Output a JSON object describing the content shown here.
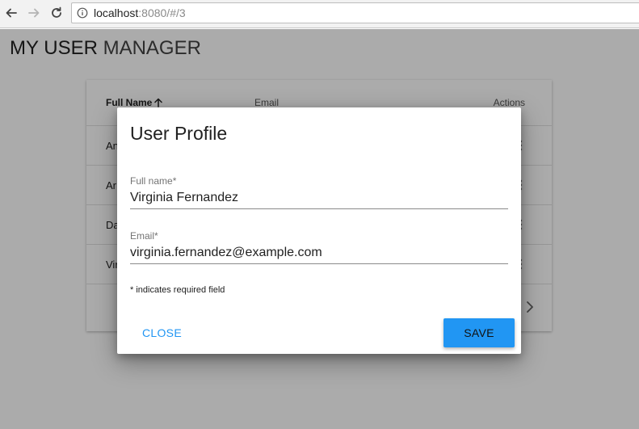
{
  "browser": {
    "url_host": "localhost",
    "url_rest": ":8080/#/3"
  },
  "app": {
    "title_first": "MY USER",
    "title_second": "MANAGER"
  },
  "table": {
    "headers": {
      "full_name": "Full Name",
      "email": "Email",
      "actions": "Actions"
    },
    "rows": [
      {
        "name_visible": "An"
      },
      {
        "name_visible": "Ar"
      },
      {
        "name_visible": "Da"
      },
      {
        "name_visible": "Vir"
      }
    ]
  },
  "dialog": {
    "title": "User Profile",
    "fields": [
      {
        "label": "Full name*",
        "value": "Virginia Fernandez"
      },
      {
        "label": "Email*",
        "value": "virginia.fernandez@example.com"
      }
    ],
    "required_note": "* indicates required field",
    "close_label": "CLOSE",
    "save_label": "SAVE"
  },
  "colors": {
    "primary": "#2196f3",
    "scrim": "rgba(0,0,0,0.33)"
  },
  "icons": {
    "back": "arrow-left-icon",
    "forward": "arrow-right-icon",
    "reload": "reload-icon",
    "info": "info-icon",
    "sort": "arrow-up-icon",
    "actions": "more-vert-icon",
    "next_page": "chevron-right-icon"
  }
}
